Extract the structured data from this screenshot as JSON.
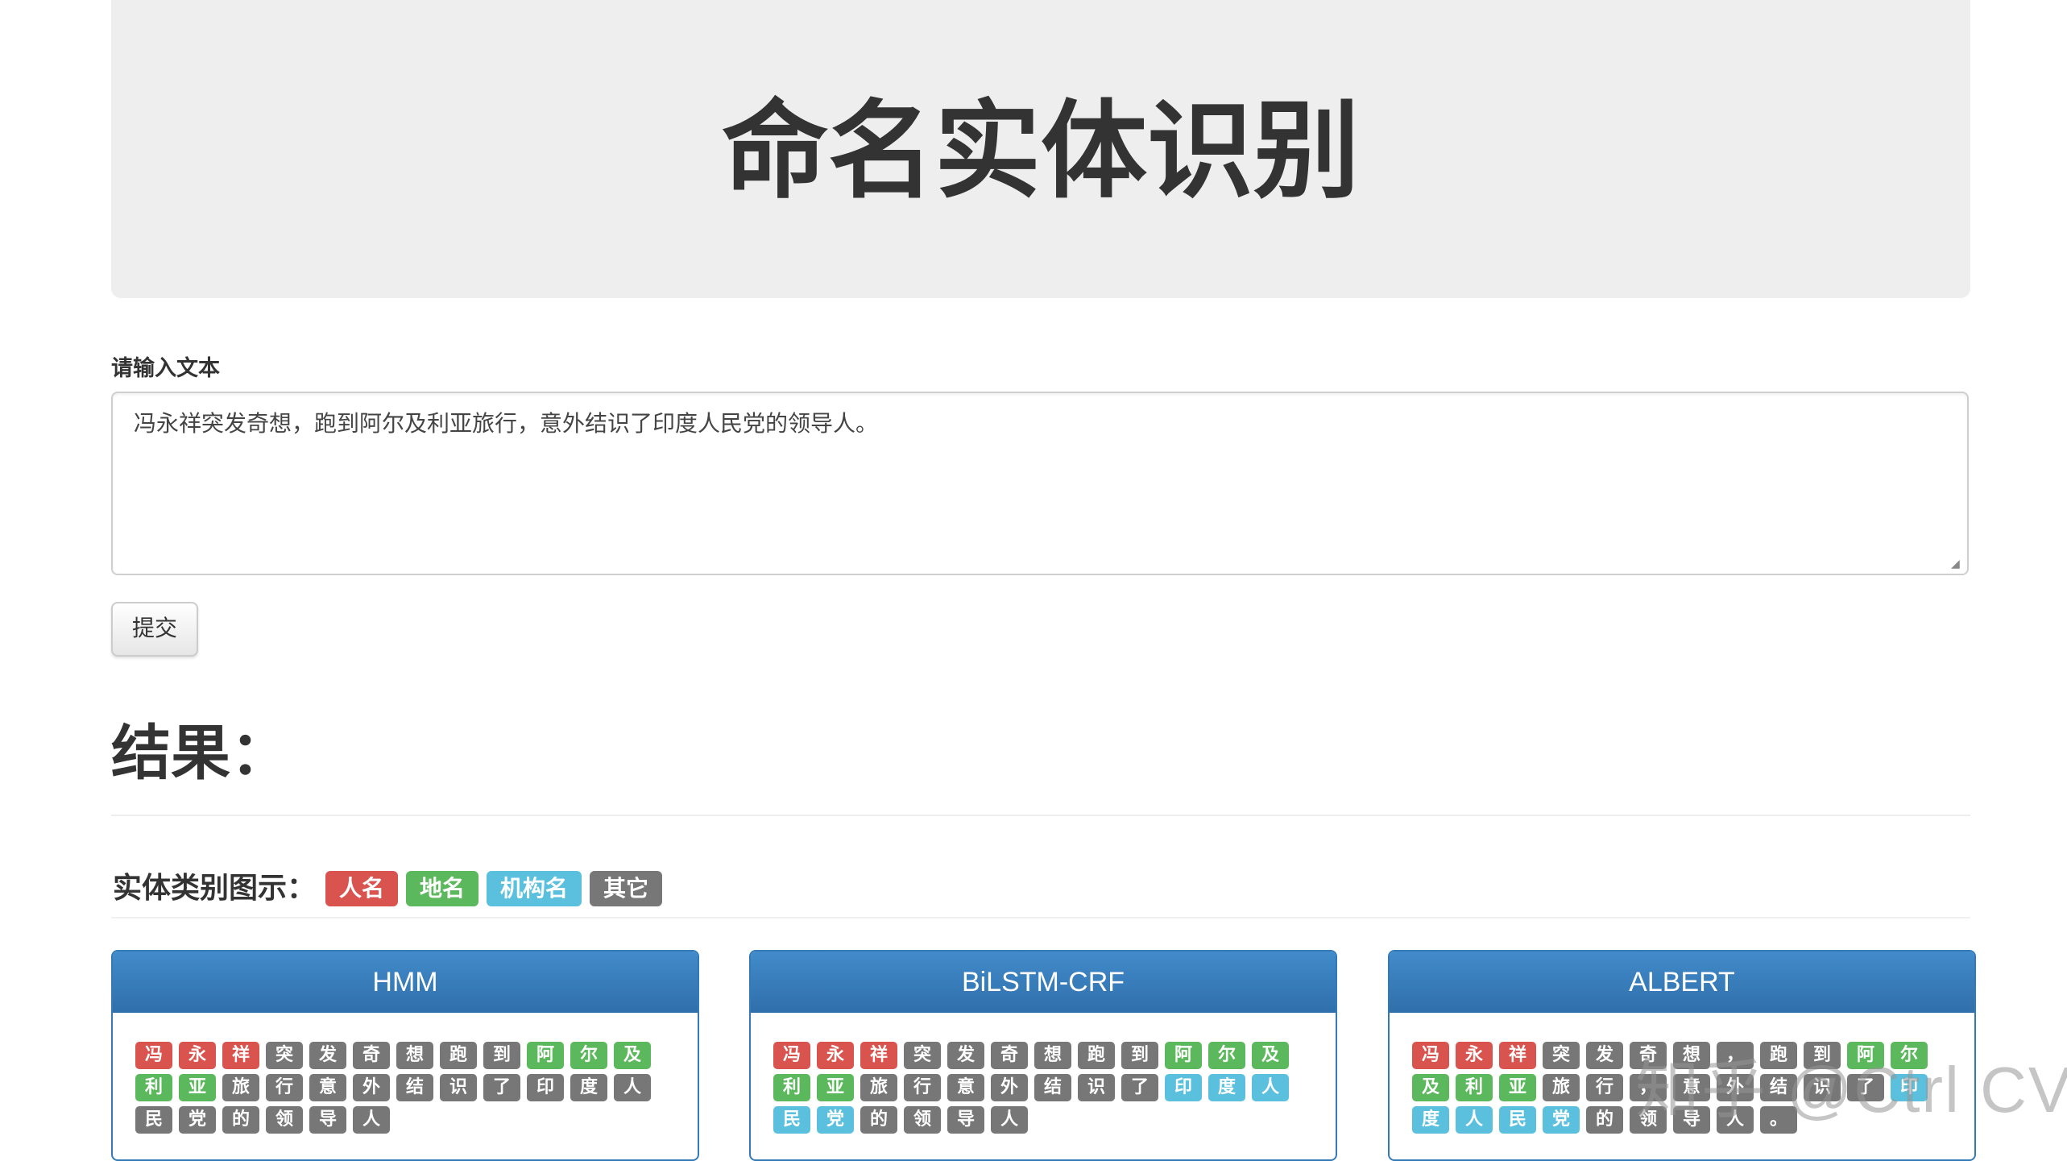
{
  "header": {
    "title": "命名实体识别"
  },
  "form": {
    "label": "请输入文本",
    "input_value": "冯永祥突发奇想，跑到阿尔及利亚旅行，意外结识了印度人民党的领导人。",
    "submit_label": "提交"
  },
  "results": {
    "heading": "结果："
  },
  "legend": {
    "title": "实体类别图示：",
    "tags": [
      {
        "label": "人名",
        "color": "#d9534f"
      },
      {
        "label": "地名",
        "color": "#5cb85c"
      },
      {
        "label": "机构名",
        "color": "#5bc0de"
      },
      {
        "label": "其它",
        "color": "#777777"
      }
    ]
  },
  "colors": {
    "per": "#d9534f",
    "loc": "#5cb85c",
    "org": "#5bc0de",
    "o": "#777777",
    "panel_header": "#337ab7"
  },
  "panels": [
    {
      "title": "HMM",
      "tokens": [
        {
          "c": "冯",
          "t": "per"
        },
        {
          "c": "永",
          "t": "per"
        },
        {
          "c": "祥",
          "t": "per"
        },
        {
          "c": "突",
          "t": "o"
        },
        {
          "c": "发",
          "t": "o"
        },
        {
          "c": "奇",
          "t": "o"
        },
        {
          "c": "想",
          "t": "o"
        },
        {
          "c": "跑",
          "t": "o"
        },
        {
          "c": "到",
          "t": "o"
        },
        {
          "c": "阿",
          "t": "loc"
        },
        {
          "c": "尔",
          "t": "loc"
        },
        {
          "c": "及",
          "t": "loc"
        },
        {
          "c": "利",
          "t": "loc"
        },
        {
          "c": "亚",
          "t": "loc"
        },
        {
          "c": "旅",
          "t": "o"
        },
        {
          "c": "行",
          "t": "o"
        },
        {
          "c": "意",
          "t": "o"
        },
        {
          "c": "外",
          "t": "o"
        },
        {
          "c": "结",
          "t": "o"
        },
        {
          "c": "识",
          "t": "o"
        },
        {
          "c": "了",
          "t": "o"
        },
        {
          "c": "印",
          "t": "o"
        },
        {
          "c": "度",
          "t": "o"
        },
        {
          "c": "人",
          "t": "o"
        },
        {
          "c": "民",
          "t": "o"
        },
        {
          "c": "党",
          "t": "o"
        },
        {
          "c": "的",
          "t": "o"
        },
        {
          "c": "领",
          "t": "o"
        },
        {
          "c": "导",
          "t": "o"
        },
        {
          "c": "人",
          "t": "o"
        }
      ]
    },
    {
      "title": "BiLSTM-CRF",
      "tokens": [
        {
          "c": "冯",
          "t": "per"
        },
        {
          "c": "永",
          "t": "per"
        },
        {
          "c": "祥",
          "t": "per"
        },
        {
          "c": "突",
          "t": "o"
        },
        {
          "c": "发",
          "t": "o"
        },
        {
          "c": "奇",
          "t": "o"
        },
        {
          "c": "想",
          "t": "o"
        },
        {
          "c": "跑",
          "t": "o"
        },
        {
          "c": "到",
          "t": "o"
        },
        {
          "c": "阿",
          "t": "loc"
        },
        {
          "c": "尔",
          "t": "loc"
        },
        {
          "c": "及",
          "t": "loc"
        },
        {
          "c": "利",
          "t": "loc"
        },
        {
          "c": "亚",
          "t": "loc"
        },
        {
          "c": "旅",
          "t": "o"
        },
        {
          "c": "行",
          "t": "o"
        },
        {
          "c": "意",
          "t": "o"
        },
        {
          "c": "外",
          "t": "o"
        },
        {
          "c": "结",
          "t": "o"
        },
        {
          "c": "识",
          "t": "o"
        },
        {
          "c": "了",
          "t": "o"
        },
        {
          "c": "印",
          "t": "org"
        },
        {
          "c": "度",
          "t": "org"
        },
        {
          "c": "人",
          "t": "org"
        },
        {
          "c": "民",
          "t": "org"
        },
        {
          "c": "党",
          "t": "org"
        },
        {
          "c": "的",
          "t": "o"
        },
        {
          "c": "领",
          "t": "o"
        },
        {
          "c": "导",
          "t": "o"
        },
        {
          "c": "人",
          "t": "o"
        }
      ]
    },
    {
      "title": "ALBERT",
      "tokens": [
        {
          "c": "冯",
          "t": "per"
        },
        {
          "c": "永",
          "t": "per"
        },
        {
          "c": "祥",
          "t": "per"
        },
        {
          "c": "突",
          "t": "o"
        },
        {
          "c": "发",
          "t": "o"
        },
        {
          "c": "奇",
          "t": "o"
        },
        {
          "c": "想",
          "t": "o"
        },
        {
          "c": "，",
          "t": "o"
        },
        {
          "c": "跑",
          "t": "o"
        },
        {
          "c": "到",
          "t": "o"
        },
        {
          "c": "阿",
          "t": "loc"
        },
        {
          "c": "尔",
          "t": "loc"
        },
        {
          "c": "及",
          "t": "loc"
        },
        {
          "c": "利",
          "t": "loc"
        },
        {
          "c": "亚",
          "t": "loc"
        },
        {
          "c": "旅",
          "t": "o"
        },
        {
          "c": "行",
          "t": "o"
        },
        {
          "c": "，",
          "t": "o"
        },
        {
          "c": "意",
          "t": "o"
        },
        {
          "c": "外",
          "t": "o"
        },
        {
          "c": "结",
          "t": "o"
        },
        {
          "c": "识",
          "t": "o"
        },
        {
          "c": "了",
          "t": "o"
        },
        {
          "c": "印",
          "t": "org"
        },
        {
          "c": "度",
          "t": "org"
        },
        {
          "c": "人",
          "t": "org"
        },
        {
          "c": "民",
          "t": "org"
        },
        {
          "c": "党",
          "t": "org"
        },
        {
          "c": "的",
          "t": "o"
        },
        {
          "c": "领",
          "t": "o"
        },
        {
          "c": "导",
          "t": "o"
        },
        {
          "c": "人",
          "t": "o"
        },
        {
          "c": "。",
          "t": "o"
        }
      ]
    }
  ],
  "watermark": "知乎 @Ctrl CV"
}
